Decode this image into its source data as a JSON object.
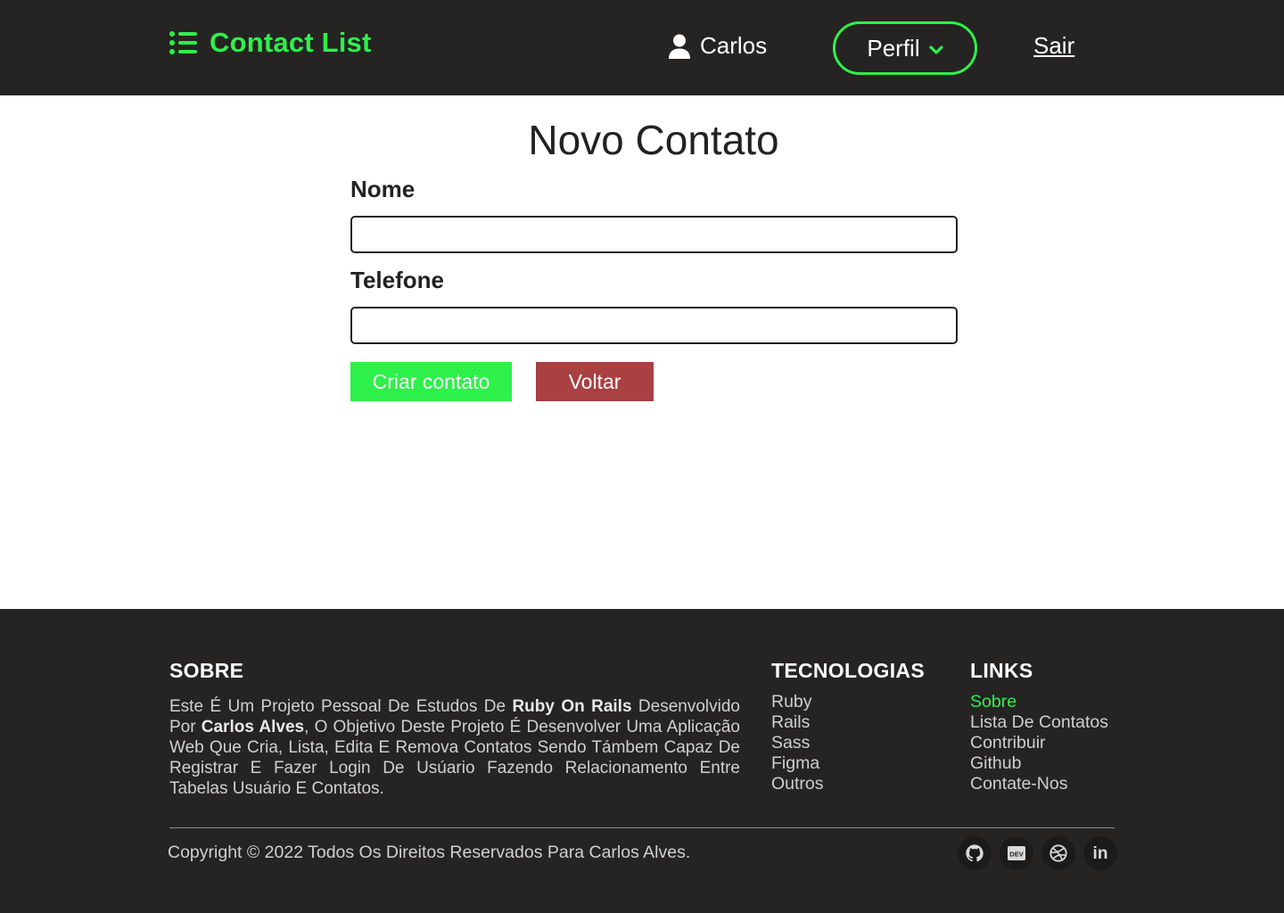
{
  "header": {
    "brand_title": "Contact List",
    "user_name": "Carlos",
    "profile_label": "Perfil",
    "logout_label": "Sair"
  },
  "main": {
    "title": "Novo Contato",
    "name_label": "Nome",
    "name_value": "",
    "phone_label": "Telefone",
    "phone_value": "",
    "create_button": "Criar contato",
    "back_button": "Voltar"
  },
  "footer": {
    "about": {
      "title": "SOBRE",
      "text_1": "Este É Um Projeto Pessoal De Estudos De ",
      "bold_1": "Ruby On Rails",
      "text_2": " Desenvolvido Por ",
      "bold_2": "Carlos Alves",
      "text_3": ", O Objetivo Deste Projeto É Desenvolver Uma Aplicação Web Que Cria, Lista, Edita E Remova Contatos Sendo Támbem Capaz De Registrar E Fazer Login De Usúario Fazendo Relacionamento Entre Tabelas Usuário E Contatos."
    },
    "technologies": {
      "title": "TECNOLOGIAS",
      "items": [
        "Ruby",
        "Rails",
        "Sass",
        "Figma",
        "Outros"
      ]
    },
    "links": {
      "title": "LINKS",
      "items": [
        "Sobre",
        "Lista De Contatos",
        "Contribuir",
        "Github",
        "Contate-Nos"
      ],
      "active_index": 0
    },
    "copyright": "Copyright © 2022 Todos Os Direitos Reservados Para Carlos Alves.",
    "socials": [
      "github-icon",
      "dev-icon",
      "dribbble-icon",
      "linkedin-icon"
    ],
    "dev_badge_text": "DEV",
    "linkedin_text": "in"
  },
  "colors": {
    "accent": "#2ef04a",
    "dark": "#252423",
    "danger": "#a94042"
  }
}
